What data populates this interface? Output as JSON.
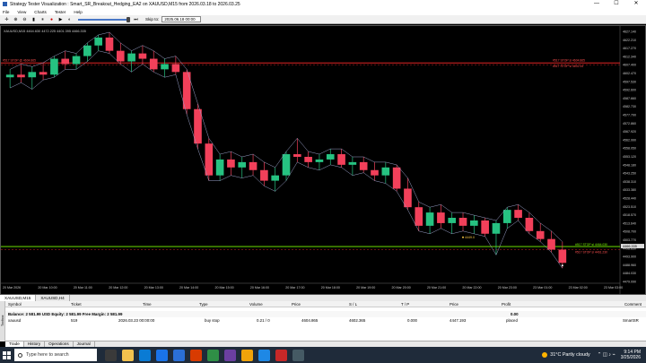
{
  "window": {
    "title": "Strategy Tester Visualization : Smart_SR_Breakout_Hedging_EA2 on XAUUSD,M15 from 2026.03.18 to 2026.03.25",
    "controls": [
      "—",
      "☐",
      "✕"
    ]
  },
  "menu": [
    "File",
    "View",
    "Charts",
    "Tester",
    "Help"
  ],
  "toolbar": {
    "skip_label": "Skip to:",
    "skip_value": "2025.06.18 00:00"
  },
  "chart": {
    "info_label": "XAUUSD,M15  4464.630  4472.225  4401.395  4466.335",
    "order_line_label": "#517 STOP  @ 4604.865",
    "sl_label": "#517 STOP sl 4604.865",
    "tp_label": "#517 STOP sl 4602.34",
    "lower_label_1": "#517 STOP sl 4464.030",
    "lower_label_2": "#517 STOP sl 4461.230",
    "entry_label": "4449.0",
    "price_axis": [
      "4627.140",
      "4622.210",
      "4617.270",
      "4612.340",
      "4607.400",
      "4602.470",
      "4597.530",
      "4592.600",
      "4587.660",
      "4582.730",
      "4577.790",
      "4572.860",
      "4567.920",
      "4562.990",
      "4558.050",
      "4553.120",
      "4548.180",
      "4543.250",
      "4538.310",
      "4533.380",
      "4528.440",
      "4523.510",
      "4518.570",
      "4513.640",
      "4508.700",
      "4503.770",
      "4498.830",
      "4493.900",
      "4488.960",
      "4484.030",
      "4479.090"
    ],
    "current_price": "4466.335",
    "time_axis": [
      "20 Mar 2026",
      "20 Mar 10:00",
      "20 Mar 11:00",
      "20 Mar 12:00",
      "20 Mar 13:00",
      "20 Mar 14:00",
      "20 Mar 15:00",
      "20 Mar 16:00",
      "20 Mar 17:00",
      "20 Mar 18:00",
      "20 Mar 19:00",
      "20 Mar 20:00",
      "20 Mar 21:00",
      "20 Mar 22:00",
      "20 Mar 23:00",
      "23 Mar 01:00",
      "23 Mar 02:00",
      "23 Mar 03:00"
    ]
  },
  "chart_data": {
    "type": "candlestick",
    "symbol": "XAUUSD",
    "timeframe": "M15",
    "candles": [
      {
        "o": 4594,
        "h": 4600,
        "l": 4586,
        "c": 4596
      },
      {
        "o": 4596,
        "h": 4604,
        "l": 4590,
        "c": 4594
      },
      {
        "o": 4594,
        "h": 4602,
        "l": 4585,
        "c": 4598
      },
      {
        "o": 4598,
        "h": 4605,
        "l": 4592,
        "c": 4596
      },
      {
        "o": 4596,
        "h": 4610,
        "l": 4594,
        "c": 4608
      },
      {
        "o": 4608,
        "h": 4614,
        "l": 4600,
        "c": 4604
      },
      {
        "o": 4604,
        "h": 4612,
        "l": 4600,
        "c": 4610
      },
      {
        "o": 4610,
        "h": 4620,
        "l": 4606,
        "c": 4618
      },
      {
        "o": 4618,
        "h": 4626,
        "l": 4614,
        "c": 4624
      },
      {
        "o": 4624,
        "h": 4628,
        "l": 4612,
        "c": 4614
      },
      {
        "o": 4614,
        "h": 4620,
        "l": 4604,
        "c": 4606
      },
      {
        "o": 4606,
        "h": 4614,
        "l": 4598,
        "c": 4612
      },
      {
        "o": 4612,
        "h": 4618,
        "l": 4604,
        "c": 4608
      },
      {
        "o": 4608,
        "h": 4614,
        "l": 4598,
        "c": 4600
      },
      {
        "o": 4600,
        "h": 4608,
        "l": 4594,
        "c": 4604
      },
      {
        "o": 4604,
        "h": 4610,
        "l": 4596,
        "c": 4598
      },
      {
        "o": 4598,
        "h": 4600,
        "l": 4566,
        "c": 4570
      },
      {
        "o": 4570,
        "h": 4574,
        "l": 4540,
        "c": 4544
      },
      {
        "o": 4544,
        "h": 4548,
        "l": 4516,
        "c": 4520
      },
      {
        "o": 4520,
        "h": 4536,
        "l": 4516,
        "c": 4532
      },
      {
        "o": 4532,
        "h": 4538,
        "l": 4520,
        "c": 4526
      },
      {
        "o": 4526,
        "h": 4534,
        "l": 4518,
        "c": 4530
      },
      {
        "o": 4530,
        "h": 4536,
        "l": 4520,
        "c": 4524
      },
      {
        "o": 4524,
        "h": 4530,
        "l": 4512,
        "c": 4516
      },
      {
        "o": 4516,
        "h": 4526,
        "l": 4508,
        "c": 4520
      },
      {
        "o": 4520,
        "h": 4538,
        "l": 4516,
        "c": 4536
      },
      {
        "o": 4536,
        "h": 4548,
        "l": 4530,
        "c": 4534
      },
      {
        "o": 4534,
        "h": 4538,
        "l": 4526,
        "c": 4530
      },
      {
        "o": 4530,
        "h": 4536,
        "l": 4524,
        "c": 4532
      },
      {
        "o": 4532,
        "h": 4540,
        "l": 4528,
        "c": 4536
      },
      {
        "o": 4536,
        "h": 4540,
        "l": 4526,
        "c": 4528
      },
      {
        "o": 4528,
        "h": 4534,
        "l": 4520,
        "c": 4530
      },
      {
        "o": 4530,
        "h": 4534,
        "l": 4522,
        "c": 4524
      },
      {
        "o": 4524,
        "h": 4530,
        "l": 4516,
        "c": 4520
      },
      {
        "o": 4520,
        "h": 4530,
        "l": 4514,
        "c": 4526
      },
      {
        "o": 4526,
        "h": 4528,
        "l": 4508,
        "c": 4510
      },
      {
        "o": 4510,
        "h": 4518,
        "l": 4494,
        "c": 4496
      },
      {
        "o": 4496,
        "h": 4500,
        "l": 4478,
        "c": 4482
      },
      {
        "o": 4482,
        "h": 4496,
        "l": 4476,
        "c": 4492
      },
      {
        "o": 4492,
        "h": 4498,
        "l": 4480,
        "c": 4484
      },
      {
        "o": 4484,
        "h": 4492,
        "l": 4476,
        "c": 4488
      },
      {
        "o": 4488,
        "h": 4492,
        "l": 4478,
        "c": 4482
      },
      {
        "o": 4482,
        "h": 4490,
        "l": 4476,
        "c": 4486
      },
      {
        "o": 4486,
        "h": 4488,
        "l": 4474,
        "c": 4476
      },
      {
        "o": 4476,
        "h": 4486,
        "l": 4460,
        "c": 4484
      },
      {
        "o": 4484,
        "h": 4496,
        "l": 4480,
        "c": 4494
      },
      {
        "o": 4494,
        "h": 4498,
        "l": 4486,
        "c": 4488
      },
      {
        "o": 4488,
        "h": 4492,
        "l": 4476,
        "c": 4478
      },
      {
        "o": 4478,
        "h": 4484,
        "l": 4470,
        "c": 4472
      },
      {
        "o": 4472,
        "h": 4478,
        "l": 4462,
        "c": 4464
      },
      {
        "o": 4464,
        "h": 4470,
        "l": 4450,
        "c": 4454
      }
    ],
    "levels": {
      "order": 4604.865,
      "lower_green": 4466.335,
      "stop_sl": 4464.03
    }
  },
  "symbol_tabs": [
    "XAUUSD,M15",
    "XAUUSD,H4"
  ],
  "terminal": {
    "side_label": "Toolbox",
    "columns": [
      "Symbol",
      "Ticket",
      "Time",
      "Type",
      "Volume",
      "Price",
      "S / L",
      "T / P",
      "Price",
      "Profit",
      "Comment"
    ],
    "balance_line": "Balance: 2 581.99 USD  Equity: 2 581.99  Free Margin: 2 581.99",
    "balance_profit": "0.00",
    "rows": [
      {
        "symbol": "xauusd",
        "ticket": "519",
        "time": "2026.03.23 00:00:00",
        "type": "buy stop",
        "volume": "0.21 / 0",
        "price": "4604.865",
        "sl": "4602.365",
        "tp": "0.000",
        "cur": "4447.193",
        "profit": "placed",
        "comment": "SmartSR"
      }
    ],
    "tabs": [
      "Trade",
      "History",
      "Operations",
      "Journal"
    ]
  },
  "taskbar": {
    "search_placeholder": "Type here to search",
    "weather": "31°C  Partly cloudy",
    "time": "9:14 PM",
    "date": "3/25/2026"
  }
}
